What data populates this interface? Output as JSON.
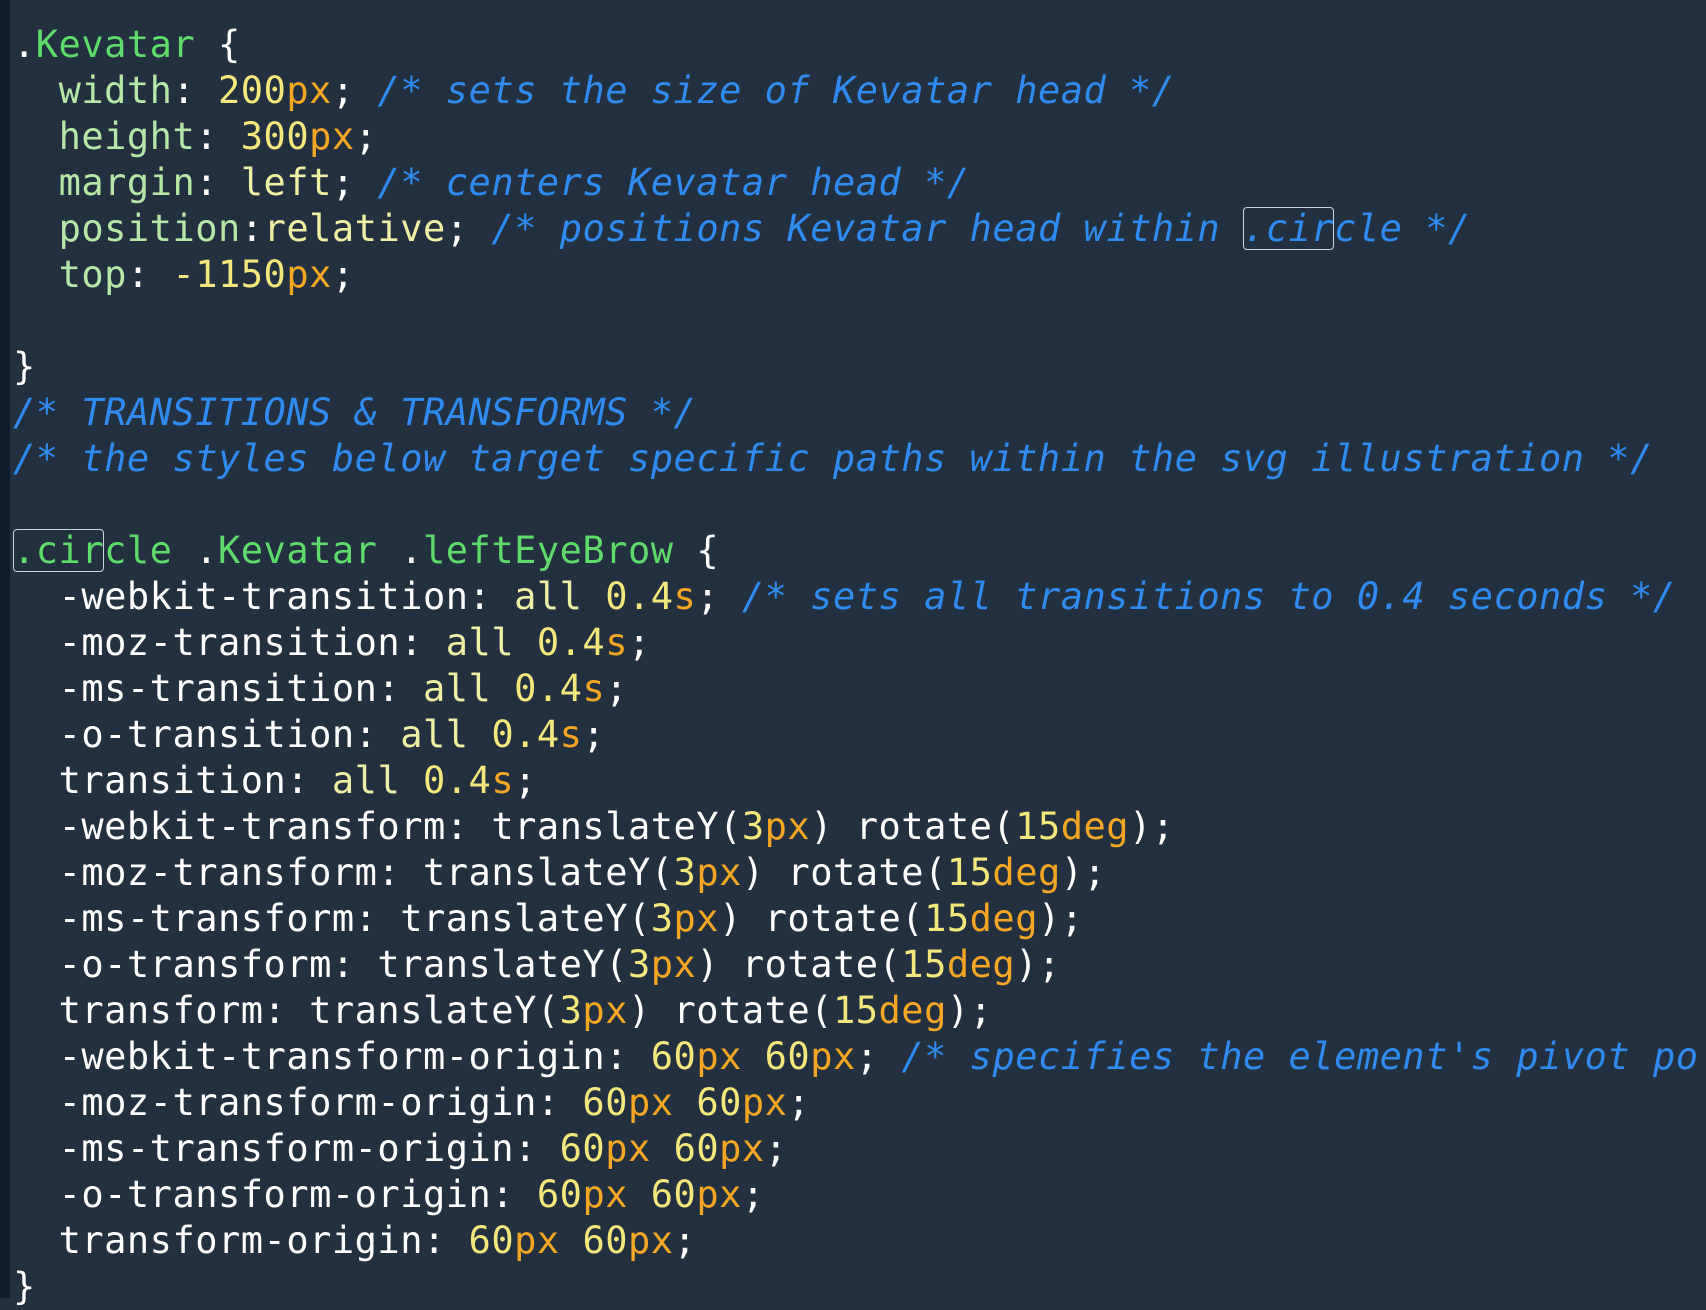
{
  "editor": {
    "theme_colors": {
      "background": "#22303f",
      "gutter": "#0f1c2a",
      "selector": "#5fdb6b",
      "property": "#b7e6a6",
      "value": "#eef0a3",
      "number": "#f4e87d",
      "unit": "#f5a623",
      "comment": "#2f8bf0",
      "punctuation": "#ffffff"
    },
    "lines": [
      [
        {
          "t": ".",
          "c": "punct"
        },
        {
          "t": "Kevatar",
          "c": "selector"
        },
        {
          "t": " {",
          "c": "punct"
        }
      ],
      [
        {
          "t": "  ",
          "c": "plain"
        },
        {
          "t": "width",
          "c": "prop"
        },
        {
          "t": ": ",
          "c": "punct"
        },
        {
          "t": "200",
          "c": "number"
        },
        {
          "t": "px",
          "c": "unit"
        },
        {
          "t": "; ",
          "c": "punct"
        },
        {
          "t": "/* sets the size of Kevatar head */",
          "c": "comment"
        }
      ],
      [
        {
          "t": "  ",
          "c": "plain"
        },
        {
          "t": "height",
          "c": "prop"
        },
        {
          "t": ": ",
          "c": "punct"
        },
        {
          "t": "300",
          "c": "number"
        },
        {
          "t": "px",
          "c": "unit"
        },
        {
          "t": ";",
          "c": "punct"
        }
      ],
      [
        {
          "t": "  ",
          "c": "plain"
        },
        {
          "t": "margin",
          "c": "prop"
        },
        {
          "t": ": ",
          "c": "punct"
        },
        {
          "t": "left",
          "c": "value"
        },
        {
          "t": "; ",
          "c": "punct"
        },
        {
          "t": "/* centers Kevatar head */",
          "c": "comment"
        }
      ],
      [
        {
          "t": "  ",
          "c": "plain"
        },
        {
          "t": "position",
          "c": "prop"
        },
        {
          "t": ":",
          "c": "punct"
        },
        {
          "t": "relative",
          "c": "value"
        },
        {
          "t": "; ",
          "c": "punct"
        },
        {
          "t": "/* positions Kevatar head within ",
          "c": "comment"
        },
        {
          "t": ".cir",
          "c": "comment",
          "hl": true
        },
        {
          "t": "cle */",
          "c": "comment"
        }
      ],
      [
        {
          "t": "  ",
          "c": "plain"
        },
        {
          "t": "top",
          "c": "prop"
        },
        {
          "t": ": ",
          "c": "punct"
        },
        {
          "t": "-1150",
          "c": "number"
        },
        {
          "t": "px",
          "c": "unit"
        },
        {
          "t": ";",
          "c": "punct"
        }
      ],
      [],
      [
        {
          "t": "}",
          "c": "punct"
        }
      ],
      [
        {
          "t": "/* TRANSITIONS & TRANSFORMS */",
          "c": "comment"
        }
      ],
      [
        {
          "t": "/* the styles below target specific paths within the svg illustration */",
          "c": "comment"
        }
      ],
      [],
      [
        {
          "t": ".cir",
          "c": "selector",
          "hl": true
        },
        {
          "t": "cle",
          "c": "selector"
        },
        {
          "t": " .",
          "c": "punct"
        },
        {
          "t": "Kevatar",
          "c": "selector"
        },
        {
          "t": " .",
          "c": "punct"
        },
        {
          "t": "leftEyeBrow",
          "c": "selector"
        },
        {
          "t": " {",
          "c": "punct"
        }
      ],
      [
        {
          "t": "  ",
          "c": "plain"
        },
        {
          "t": "-webkit-transition",
          "c": "prefixed"
        },
        {
          "t": ": ",
          "c": "punct"
        },
        {
          "t": "all ",
          "c": "value"
        },
        {
          "t": "0.4",
          "c": "number"
        },
        {
          "t": "s",
          "c": "unit"
        },
        {
          "t": "; ",
          "c": "punct"
        },
        {
          "t": "/* sets all transitions to 0.4 seconds */",
          "c": "comment"
        }
      ],
      [
        {
          "t": "  ",
          "c": "plain"
        },
        {
          "t": "-moz-transition",
          "c": "prefixed"
        },
        {
          "t": ": ",
          "c": "punct"
        },
        {
          "t": "all ",
          "c": "value"
        },
        {
          "t": "0.4",
          "c": "number"
        },
        {
          "t": "s",
          "c": "unit"
        },
        {
          "t": ";",
          "c": "punct"
        }
      ],
      [
        {
          "t": "  ",
          "c": "plain"
        },
        {
          "t": "-ms-transition",
          "c": "prefixed"
        },
        {
          "t": ": ",
          "c": "punct"
        },
        {
          "t": "all ",
          "c": "value"
        },
        {
          "t": "0.4",
          "c": "number"
        },
        {
          "t": "s",
          "c": "unit"
        },
        {
          "t": ";",
          "c": "punct"
        }
      ],
      [
        {
          "t": "  ",
          "c": "plain"
        },
        {
          "t": "-o-transition",
          "c": "prefixed"
        },
        {
          "t": ": ",
          "c": "punct"
        },
        {
          "t": "all ",
          "c": "value"
        },
        {
          "t": "0.4",
          "c": "number"
        },
        {
          "t": "s",
          "c": "unit"
        },
        {
          "t": ";",
          "c": "punct"
        }
      ],
      [
        {
          "t": "  ",
          "c": "plain"
        },
        {
          "t": "transition",
          "c": "prefixed"
        },
        {
          "t": ": ",
          "c": "punct"
        },
        {
          "t": "all ",
          "c": "value"
        },
        {
          "t": "0.4",
          "c": "number"
        },
        {
          "t": "s",
          "c": "unit"
        },
        {
          "t": ";",
          "c": "punct"
        }
      ],
      [
        {
          "t": "  ",
          "c": "plain"
        },
        {
          "t": "-webkit-transform",
          "c": "prefixed"
        },
        {
          "t": ": translateY(",
          "c": "punct"
        },
        {
          "t": "3",
          "c": "number"
        },
        {
          "t": "px",
          "c": "unit"
        },
        {
          "t": ") rotate(",
          "c": "punct"
        },
        {
          "t": "15",
          "c": "number"
        },
        {
          "t": "deg",
          "c": "unit"
        },
        {
          "t": ");",
          "c": "punct"
        }
      ],
      [
        {
          "t": "  ",
          "c": "plain"
        },
        {
          "t": "-moz-transform",
          "c": "prefixed"
        },
        {
          "t": ": translateY(",
          "c": "punct"
        },
        {
          "t": "3",
          "c": "number"
        },
        {
          "t": "px",
          "c": "unit"
        },
        {
          "t": ") rotate(",
          "c": "punct"
        },
        {
          "t": "15",
          "c": "number"
        },
        {
          "t": "deg",
          "c": "unit"
        },
        {
          "t": ");",
          "c": "punct"
        }
      ],
      [
        {
          "t": "  ",
          "c": "plain"
        },
        {
          "t": "-ms-transform",
          "c": "prefixed"
        },
        {
          "t": ": translateY(",
          "c": "punct"
        },
        {
          "t": "3",
          "c": "number"
        },
        {
          "t": "px",
          "c": "unit"
        },
        {
          "t": ") rotate(",
          "c": "punct"
        },
        {
          "t": "15",
          "c": "number"
        },
        {
          "t": "deg",
          "c": "unit"
        },
        {
          "t": ");",
          "c": "punct"
        }
      ],
      [
        {
          "t": "  ",
          "c": "plain"
        },
        {
          "t": "-o-transform",
          "c": "prefixed"
        },
        {
          "t": ": translateY(",
          "c": "punct"
        },
        {
          "t": "3",
          "c": "number"
        },
        {
          "t": "px",
          "c": "unit"
        },
        {
          "t": ") rotate(",
          "c": "punct"
        },
        {
          "t": "15",
          "c": "number"
        },
        {
          "t": "deg",
          "c": "unit"
        },
        {
          "t": ");",
          "c": "punct"
        }
      ],
      [
        {
          "t": "  ",
          "c": "plain"
        },
        {
          "t": "transform",
          "c": "prefixed"
        },
        {
          "t": ": translateY(",
          "c": "punct"
        },
        {
          "t": "3",
          "c": "number"
        },
        {
          "t": "px",
          "c": "unit"
        },
        {
          "t": ") rotate(",
          "c": "punct"
        },
        {
          "t": "15",
          "c": "number"
        },
        {
          "t": "deg",
          "c": "unit"
        },
        {
          "t": ");",
          "c": "punct"
        }
      ],
      [
        {
          "t": "  ",
          "c": "plain"
        },
        {
          "t": "-webkit-transform-origin",
          "c": "prefixed"
        },
        {
          "t": ": ",
          "c": "punct"
        },
        {
          "t": "60",
          "c": "number"
        },
        {
          "t": "px",
          "c": "unit"
        },
        {
          "t": " ",
          "c": "punct"
        },
        {
          "t": "60",
          "c": "number"
        },
        {
          "t": "px",
          "c": "unit"
        },
        {
          "t": "; ",
          "c": "punct"
        },
        {
          "t": "/* specifies the element's pivot po",
          "c": "comment"
        }
      ],
      [
        {
          "t": "  ",
          "c": "plain"
        },
        {
          "t": "-moz-transform-origin",
          "c": "prefixed"
        },
        {
          "t": ": ",
          "c": "punct"
        },
        {
          "t": "60",
          "c": "number"
        },
        {
          "t": "px",
          "c": "unit"
        },
        {
          "t": " ",
          "c": "punct"
        },
        {
          "t": "60",
          "c": "number"
        },
        {
          "t": "px",
          "c": "unit"
        },
        {
          "t": ";",
          "c": "punct"
        }
      ],
      [
        {
          "t": "  ",
          "c": "plain"
        },
        {
          "t": "-ms-transform-origin",
          "c": "prefixed"
        },
        {
          "t": ": ",
          "c": "punct"
        },
        {
          "t": "60",
          "c": "number"
        },
        {
          "t": "px",
          "c": "unit"
        },
        {
          "t": " ",
          "c": "punct"
        },
        {
          "t": "60",
          "c": "number"
        },
        {
          "t": "px",
          "c": "unit"
        },
        {
          "t": ";",
          "c": "punct"
        }
      ],
      [
        {
          "t": "  ",
          "c": "plain"
        },
        {
          "t": "-o-transform-origin",
          "c": "prefixed"
        },
        {
          "t": ": ",
          "c": "punct"
        },
        {
          "t": "60",
          "c": "number"
        },
        {
          "t": "px",
          "c": "unit"
        },
        {
          "t": " ",
          "c": "punct"
        },
        {
          "t": "60",
          "c": "number"
        },
        {
          "t": "px",
          "c": "unit"
        },
        {
          "t": ";",
          "c": "punct"
        }
      ],
      [
        {
          "t": "  ",
          "c": "plain"
        },
        {
          "t": "transform-origin",
          "c": "prefixed"
        },
        {
          "t": ": ",
          "c": "punct"
        },
        {
          "t": "60",
          "c": "number"
        },
        {
          "t": "px",
          "c": "unit"
        },
        {
          "t": " ",
          "c": "punct"
        },
        {
          "t": "60",
          "c": "number"
        },
        {
          "t": "px",
          "c": "unit"
        },
        {
          "t": ";",
          "c": "punct"
        }
      ],
      [
        {
          "t": "}",
          "c": "punct"
        }
      ]
    ]
  }
}
